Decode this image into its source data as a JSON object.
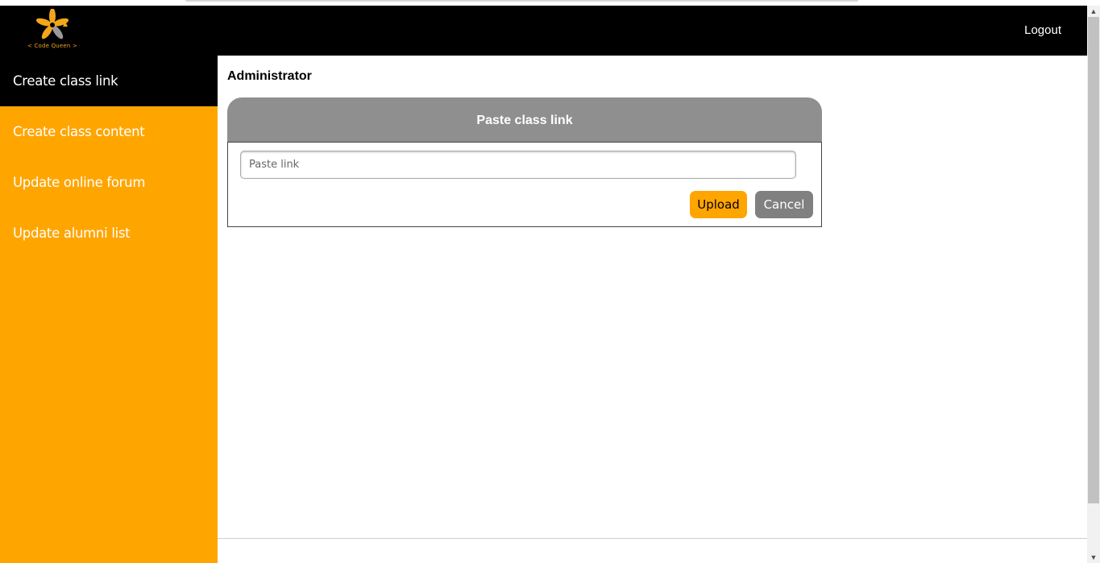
{
  "header": {
    "logo_text": "< Code Queen >",
    "logout_label": "Logout"
  },
  "sidebar": {
    "items": [
      {
        "label": "Create class link",
        "active": true
      },
      {
        "label": "Create class content",
        "active": false
      },
      {
        "label": "Update online forum",
        "active": false
      },
      {
        "label": "Update alumni list",
        "active": false
      }
    ]
  },
  "main": {
    "title": "Administrator",
    "card": {
      "heading": "Paste class link",
      "input_placeholder": "Paste link",
      "input_value": "",
      "upload_label": "Upload",
      "cancel_label": "Cancel"
    }
  },
  "colors": {
    "accent": "#ffa500",
    "header_bg": "#000000",
    "card_header_bg": "#8f8f8f",
    "cancel_bg": "#808080"
  },
  "icons": {
    "logo": "flower-logo-icon",
    "scroll_up": "scroll-up-arrow-icon",
    "scroll_down": "scroll-down-arrow-icon"
  }
}
